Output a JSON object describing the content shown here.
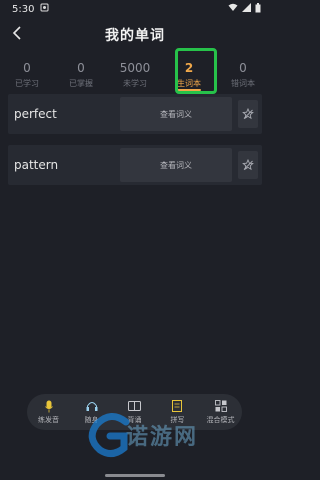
{
  "status_bar": {
    "time": "5:30",
    "icons": [
      "notification-icon",
      "wifi-icon",
      "signal-icon",
      "battery-icon"
    ]
  },
  "header": {
    "title": "我的单词",
    "back_icon": "chevron-left-icon"
  },
  "tabs": [
    {
      "count": "0",
      "label": "已学习"
    },
    {
      "count": "0",
      "label": "已掌握"
    },
    {
      "count": "5000",
      "label": "未学习"
    },
    {
      "count": "2",
      "label": "生词本",
      "active": true
    },
    {
      "count": "0",
      "label": "错词本"
    }
  ],
  "words": [
    {
      "word": "perfect",
      "view_label": "查看词义",
      "icon": "unstar-icon"
    },
    {
      "word": "pattern",
      "view_label": "查看词义",
      "icon": "unstar-icon"
    }
  ],
  "bottom_nav": [
    {
      "label": "练发音",
      "icon": "microphone-icon"
    },
    {
      "label": "随身",
      "icon": "headphone-icon"
    },
    {
      "label": "背诵",
      "icon": "book-icon"
    },
    {
      "label": "拼写",
      "icon": "pencil-icon"
    },
    {
      "label": "混合模式",
      "icon": "mix-icon"
    }
  ],
  "watermark": {
    "text": "诺游网",
    "icon": "g-logo-icon"
  },
  "colors": {
    "accent": "#f0a84a",
    "highlight": "#27c24a",
    "background": "#1e2027"
  }
}
